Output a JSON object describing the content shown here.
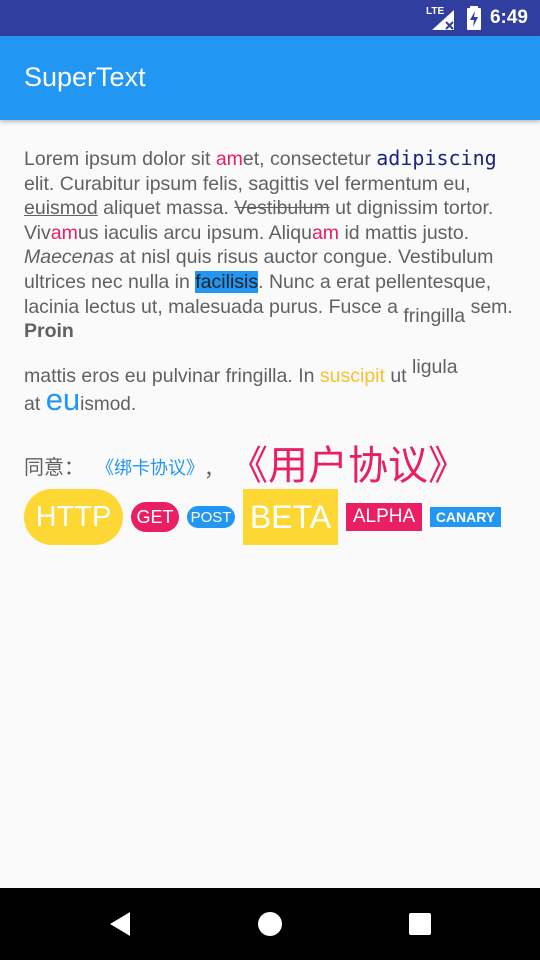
{
  "status_bar": {
    "network_label": "LTE",
    "time": "6:49",
    "icons": [
      "lte-signal-icon",
      "battery-charging-icon"
    ]
  },
  "app_bar": {
    "title": "SuperText"
  },
  "paragraph": {
    "seg1": "Lorem ipsum dolor sit ",
    "am1": "am",
    "seg2": "et, consectetur ",
    "adipiscing": "adipiscing",
    "seg3": " elit. Curabitur ipsum felis, sagittis vel fermentum eu, ",
    "euismod": "euismod",
    "seg4": " aliquet massa. ",
    "vestibulum": "Vestibulum",
    "seg5": " ut dignissim tortor. Viv",
    "am2": "am",
    "seg6": "us iaculis arcu ipsum. Aliqu",
    "am3": "am",
    "seg7": " id mattis justo. ",
    "maecenas": "Maecenas",
    "seg8": " at nisl quis risus auctor congue. Vestibulum ultrices nec nulla in ",
    "facilisis": "facilisis",
    "seg9": ". Nunc a erat pellentesque, lacinia lectus ut, malesuada purus. Fusce a ",
    "fringilla_sub": "fringilla",
    "seg10": " sem. ",
    "proin": "Proin",
    "seg11": " mattis eros eu pulvinar fringilla. In ",
    "suscipit": "suscipit",
    "seg12": " ut ",
    "ligula_sup": "ligula",
    "seg13": " at ",
    "eu_big": "eu",
    "seg14": "ismod."
  },
  "consent": {
    "label": "同意：",
    "link1": "《绑卡协议》",
    "comma": "，",
    "link2": "《用户协议》"
  },
  "tags": {
    "http": "HTTP",
    "get": "GET",
    "post": "POST",
    "beta": "BETA",
    "alpha": "ALPHA",
    "canary": "CANARY"
  },
  "colors": {
    "status_bar": "#303f9f",
    "app_bar": "#2196f3",
    "pink": "#e91e63",
    "yellow": "#fdd835",
    "blue": "#2196f3",
    "body_text": "#616161"
  },
  "nav_bar": {
    "icons": [
      "back-icon",
      "home-icon",
      "recents-icon"
    ]
  }
}
